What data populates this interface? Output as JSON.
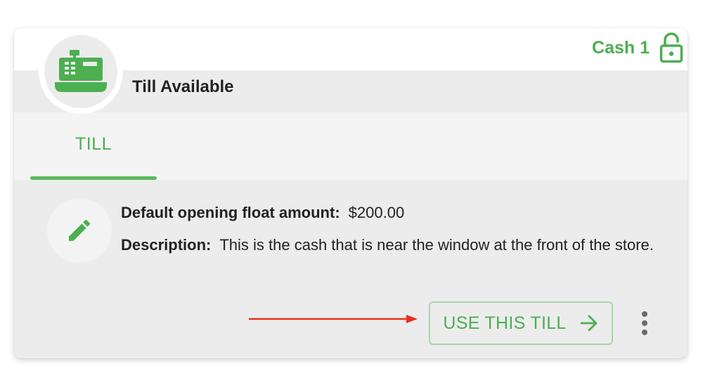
{
  "card": {
    "status": "Till Available",
    "till_name": "Cash 1",
    "icons": {
      "avatar": "cash-register-icon",
      "lock": "lock-open-icon",
      "edit": "pencil-icon",
      "arrow": "arrow-right-icon",
      "more": "more-vertical-icon"
    }
  },
  "tabs": [
    {
      "label": "TILL",
      "active": true
    }
  ],
  "details": {
    "float_label": "Default opening float amount:",
    "float_value": "$200.00",
    "description_label": "Description:",
    "description_value": "This is the cash that is near the window at the front of the store."
  },
  "actions": {
    "use_till_label": "USE THIS TILL"
  },
  "colors": {
    "accent": "#4caf50",
    "annotation_arrow": "#e53020"
  }
}
